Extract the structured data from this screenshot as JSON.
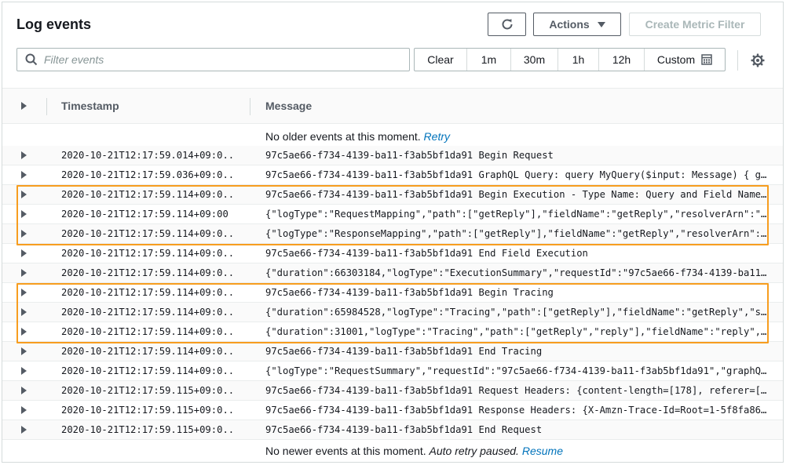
{
  "header": {
    "title": "Log events",
    "actions_label": "Actions",
    "create_metric_filter_label": "Create Metric Filter"
  },
  "filter": {
    "placeholder": "Filter events",
    "value": ""
  },
  "time_range": {
    "clear": "Clear",
    "m1": "1m",
    "m30": "30m",
    "h1": "1h",
    "h12": "12h",
    "custom": "Custom"
  },
  "table": {
    "col_timestamp": "Timestamp",
    "col_message": "Message"
  },
  "notices": {
    "top_text": "No older events at this moment.",
    "top_link": "Retry",
    "bottom_text": "No newer events at this moment.",
    "bottom_italic": "Auto retry paused.",
    "bottom_link": "Resume"
  },
  "colors": {
    "highlight": "#f79d1f",
    "link": "#0073bb"
  },
  "rows": [
    {
      "ts": "2020-10-21T12:17:59.014+09:0...",
      "msg": "97c5ae66-f734-4139-ba11-f3ab5bf1da91 Begin Request"
    },
    {
      "ts": "2020-10-21T12:17:59.036+09:0...",
      "msg": "97c5ae66-f734-4139-ba11-f3ab5bf1da91 GraphQL Query: query MyQuery($input: Message) { g..."
    },
    {
      "ts": "2020-10-21T12:17:59.114+09:0...",
      "msg": "97c5ae66-f734-4139-ba11-f3ab5bf1da91 Begin Execution - Type Name: Query and Field Name..."
    },
    {
      "ts": "2020-10-21T12:17:59.114+09:00",
      "msg": "{\"logType\":\"RequestMapping\",\"path\":[\"getReply\"],\"fieldName\":\"getReply\",\"resolverArn\":\"..."
    },
    {
      "ts": "2020-10-21T12:17:59.114+09:0...",
      "msg": "{\"logType\":\"ResponseMapping\",\"path\":[\"getReply\"],\"fieldName\":\"getReply\",\"resolverArn\":..."
    },
    {
      "ts": "2020-10-21T12:17:59.114+09:0...",
      "msg": "97c5ae66-f734-4139-ba11-f3ab5bf1da91 End Field Execution"
    },
    {
      "ts": "2020-10-21T12:17:59.114+09:0...",
      "msg": "{\"duration\":66303184,\"logType\":\"ExecutionSummary\",\"requestId\":\"97c5ae66-f734-4139-ba11..."
    },
    {
      "ts": "2020-10-21T12:17:59.114+09:0...",
      "msg": "97c5ae66-f734-4139-ba11-f3ab5bf1da91 Begin Tracing"
    },
    {
      "ts": "2020-10-21T12:17:59.114+09:0...",
      "msg": "{\"duration\":65984528,\"logType\":\"Tracing\",\"path\":[\"getReply\"],\"fieldName\":\"getReply\",\"s..."
    },
    {
      "ts": "2020-10-21T12:17:59.114+09:0...",
      "msg": "{\"duration\":31001,\"logType\":\"Tracing\",\"path\":[\"getReply\",\"reply\"],\"fieldName\":\"reply\",..."
    },
    {
      "ts": "2020-10-21T12:17:59.114+09:0...",
      "msg": "97c5ae66-f734-4139-ba11-f3ab5bf1da91 End Tracing"
    },
    {
      "ts": "2020-10-21T12:17:59.114+09:0...",
      "msg": "{\"logType\":\"RequestSummary\",\"requestId\":\"97c5ae66-f734-4139-ba11-f3ab5bf1da91\",\"graphQ..."
    },
    {
      "ts": "2020-10-21T12:17:59.115+09:0...",
      "msg": "97c5ae66-f734-4139-ba11-f3ab5bf1da91 Request Headers: {content-length=[178], referer=[..."
    },
    {
      "ts": "2020-10-21T12:17:59.115+09:0...",
      "msg": "97c5ae66-f734-4139-ba11-f3ab5bf1da91 Response Headers: {X-Amzn-Trace-Id=Root=1-5f8fa86..."
    },
    {
      "ts": "2020-10-21T12:17:59.115+09:0...",
      "msg": "97c5ae66-f734-4139-ba11-f3ab5bf1da91 End Request"
    }
  ]
}
